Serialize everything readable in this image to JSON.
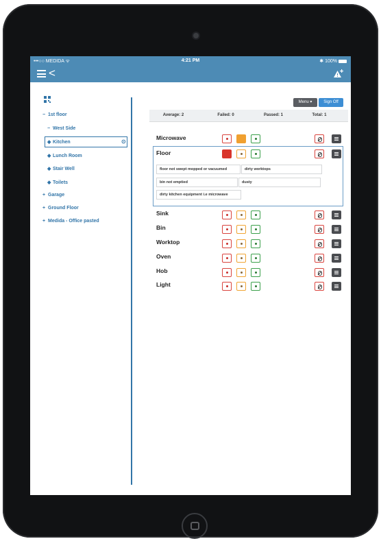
{
  "status_bar": {
    "carrier": "•••○○ MEDIDA ᯤ",
    "time": "4:21 PM",
    "battery": "✱ 100%"
  },
  "nav": {
    "back_glyph": "<"
  },
  "sidebar": {
    "collapse_glyph": "−",
    "expand_glyph": "+",
    "room_glyph": "◆",
    "target_glyph": "⊙",
    "floor_1": "1st floor",
    "west_side": "West Side",
    "kitchen": "Kitchen",
    "lunch_room": "Lunch Room",
    "stair_well": "Stair Well",
    "toilets": "Toilets",
    "garage": "Garage",
    "ground_floor": "Ground Floor",
    "office": "Medida - Office pasted"
  },
  "toolbar": {
    "menu_label": "Menu ▾",
    "signoff_label": "Sign Off"
  },
  "summary": {
    "average": "Average: 2",
    "failed": "Failed: 0",
    "passed": "Passed: 1",
    "total": "Total: 1"
  },
  "rows": {
    "microwave": "Microwave",
    "floor": "Floor",
    "sink": "Sink",
    "bin": "Bin",
    "worktop": "Worktop",
    "oven": "Oven",
    "hob": "Hob",
    "light": "Light"
  },
  "reasons": {
    "r1": "floor not swept mopped or vacuumed",
    "r2": "dirty worktops",
    "r3": "bin not emptied",
    "r4": "dusty",
    "r5": "dirty kitchen equipment i.e microwave"
  },
  "colors": {
    "header": "#4d8bb5",
    "link": "#3275a8",
    "fail": "#d9352c",
    "warn": "#f0a030",
    "pass": "#3aa04a"
  }
}
